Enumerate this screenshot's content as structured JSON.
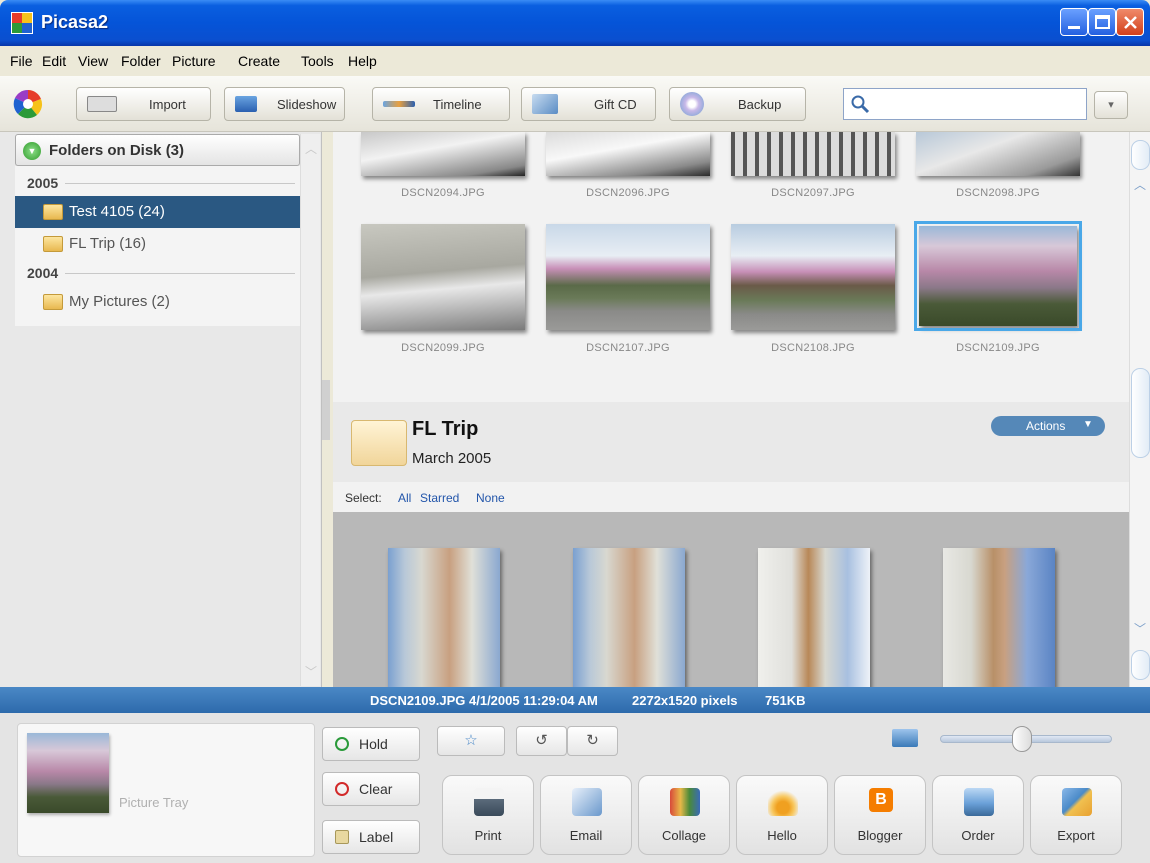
{
  "window": {
    "title": "Picasa2"
  },
  "menu": [
    "File",
    "Edit",
    "View",
    "Folder",
    "Picture",
    "Create",
    "Tools",
    "Help"
  ],
  "toolbar": {
    "import": "Import",
    "slideshow": "Slideshow",
    "timeline": "Timeline",
    "gift_cd": "Gift CD",
    "backup": "Backup",
    "search_value": ""
  },
  "folders": {
    "header": "Folders on Disk (3)",
    "groups": [
      {
        "year": "2005",
        "items": [
          {
            "label": "Test 4105 (24)",
            "selected": true
          },
          {
            "label": "FL Trip (16)",
            "selected": false
          }
        ]
      },
      {
        "year": "2004",
        "items": [
          {
            "label": "My Pictures (2)",
            "selected": false
          }
        ]
      }
    ]
  },
  "thumbnails": {
    "row1": [
      "DSCN2094.JPG",
      "DSCN2096.JPG",
      "DSCN2097.JPG",
      "DSCN2098.JPG"
    ],
    "row2": [
      "DSCN2099.JPG",
      "DSCN2107.JPG",
      "DSCN2108.JPG",
      "DSCN2109.JPG"
    ],
    "selected": "DSCN2109.JPG"
  },
  "album": {
    "title": "FL Trip",
    "date": "March 2005",
    "actions": "Actions",
    "select_label": "Select:",
    "select_all": "All",
    "select_starred": "Starred",
    "select_none": "None"
  },
  "status": {
    "filename": "DSCN2109.JPG",
    "datetime": "4/1/2005 11:29:04 AM",
    "dimensions": "2272x1520 pixels",
    "size": "751KB"
  },
  "tray": {
    "label": "Picture Tray",
    "hold": "Hold",
    "clear": "Clear",
    "label_btn": "Label"
  },
  "actions": [
    "Print",
    "Email",
    "Collage",
    "Hello",
    "Blogger",
    "Order",
    "Export"
  ],
  "colors": {
    "accent": "#2a5882",
    "status_bar": "#3a78b8",
    "title_bar": "#0554d8"
  }
}
